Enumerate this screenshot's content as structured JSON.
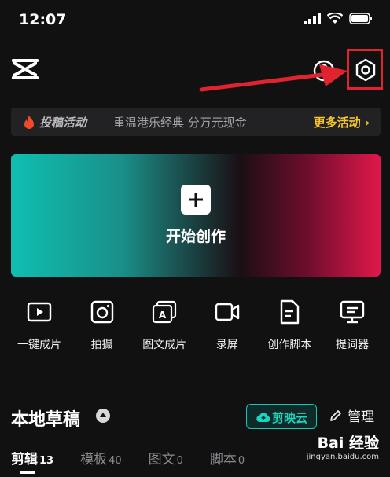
{
  "status_bar": {
    "time": "12:07"
  },
  "banner": {
    "tag": "投稿活动",
    "text": "重温港乐经典 分万元现金",
    "more": "更多活动 ›"
  },
  "start_card": {
    "label": "开始创作"
  },
  "tools": [
    {
      "label": "一键成片",
      "icon": "play-icon"
    },
    {
      "label": "拍摄",
      "icon": "camera-icon"
    },
    {
      "label": "图文成片",
      "icon": "image-text-icon"
    },
    {
      "label": "录屏",
      "icon": "video-record-icon"
    },
    {
      "label": "创作脚本",
      "icon": "script-icon"
    },
    {
      "label": "提词器",
      "icon": "teleprompter-icon"
    }
  ],
  "drafts": {
    "title": "本地草稿",
    "cloud_label": "剪映云",
    "manage_label": "管理"
  },
  "tabs": [
    {
      "label": "剪辑",
      "count": "13"
    },
    {
      "label": "模板",
      "count": "40"
    },
    {
      "label": "图文",
      "count": "0"
    },
    {
      "label": "脚本",
      "count": "0"
    }
  ],
  "watermark": {
    "main": "Bai 经验",
    "sub": "jingyan.baidu.com"
  },
  "colors": {
    "accent_teal": "#19c5b1",
    "highlight_red": "#e0232e",
    "more_yellow": "#f5c52b"
  }
}
